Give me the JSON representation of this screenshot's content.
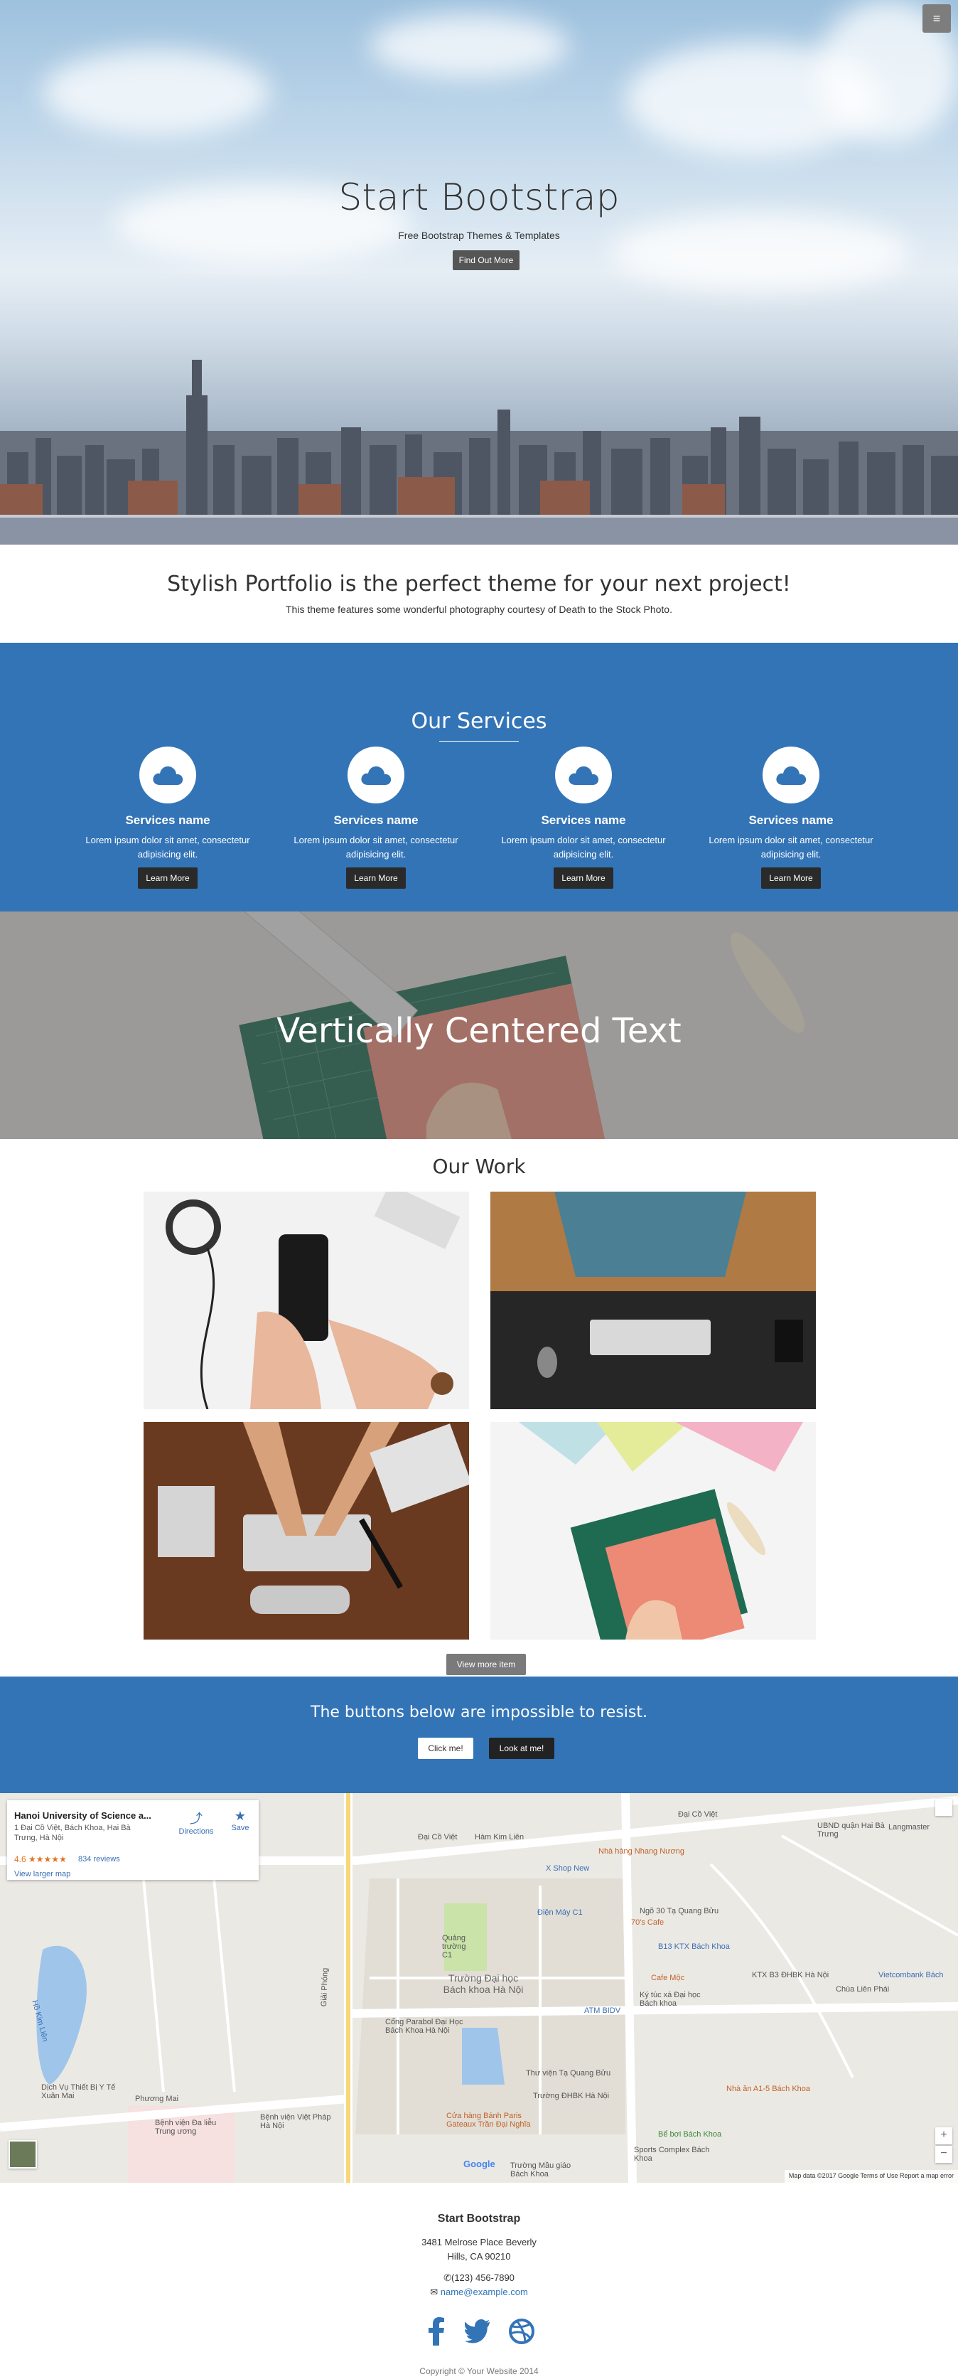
{
  "hero": {
    "title": "Start Bootstrap",
    "subtitle": "Free Bootstrap Themes & Templates",
    "button": "Find Out More",
    "menu_icon": "≡"
  },
  "about": {
    "heading": "Stylish Portfolio is the perfect theme for your next project!",
    "text": "This theme features some wonderful photography courtesy of Death to the Stock Photo."
  },
  "services": {
    "heading": "Our Services",
    "items": [
      {
        "title": "Services name",
        "text": "Lorem ipsum dolor sit amet, consectetur adipisicing elit.",
        "button": "Learn More",
        "icon": "cloud-icon"
      },
      {
        "title": "Services name",
        "text": "Lorem ipsum dolor sit amet, consectetur adipisicing elit.",
        "button": "Learn More",
        "icon": "cloud-icon"
      },
      {
        "title": "Services name",
        "text": "Lorem ipsum dolor sit amet, consectetur adipisicing elit.",
        "button": "Learn More",
        "icon": "cloud-icon"
      },
      {
        "title": "Services name",
        "text": "Lorem ipsum dolor sit amet, consectetur adipisicing elit.",
        "button": "Learn More",
        "icon": "cloud-icon"
      }
    ]
  },
  "callout": {
    "heading": "Vertically Centered Text"
  },
  "portfolio": {
    "heading": "Our Work",
    "button": "View more item"
  },
  "cta": {
    "heading": "The buttons below are impossible to resist.",
    "button1": "Click me!",
    "button2": "Look at me!"
  },
  "map": {
    "place_name": "Hanoi University of Science a...",
    "place_address": "1 Đại Cồ Việt, Bách Khoa, Hai Bà Trưng, Hà Nội",
    "rating": "4.6",
    "stars": "★★★★★",
    "reviews": "834 reviews",
    "larger_map": "View larger map",
    "directions": "Directions",
    "save": "Save",
    "labels": {
      "dai_co_viet": "Đại Cồ Việt",
      "ham_kim_lien": "Hàm Kim Liên",
      "nha_hang": "Nhà hàng Nhang Nương",
      "x_shop": "X Shop New",
      "dien_may": "Điện Máy C1",
      "seventy": "70's Cafe",
      "cafe_moc": "Cafe Mộc",
      "ktx_b3": "B13 KTX Bách Khoa",
      "ktx_b3_2": "KTX B3 ĐHBK Hà Nội",
      "ky_tuc": "Ký túc xá Đại học Bách khoa",
      "atm": "ATM BIDV",
      "truong": "Trường Đại học Bách khoa Hà Nội",
      "cong_parabol": "Cổng Parabol Đại Học Bách Khoa Hà Nội",
      "thu_vien": "Thư viện Tạ Quang Bửu",
      "dhbk": "Trường ĐHBK Hà Nội",
      "quang_truong": "Quảng trường C1",
      "giai_phong": "Giải Phóng",
      "ho_kim_lien": "Hồ Kim Liên",
      "benh_vien": "Bệnh viện Đa liễu Trung ương",
      "benh_vien_phap": "Bệnh viện Việt Pháp Hà Nội",
      "dich_vu": "Dịch Vụ Thiết Bị Y Tế Xuân Mai",
      "phuong_mai": "Phương Mai",
      "cua_hang": "Cửa hàng Bánh Paris Gateaux Trần Đại Nghĩa",
      "be_boi": "Bể bơi Bách Khoa",
      "sports": "Sports Complex Bách Khoa",
      "truong_mau": "Trường Mầu giáo Bách Khoa",
      "nha_an": "Nhà ăn A1-5 Bách Khoa",
      "chua_lien": "Chùa Liên Phái",
      "viettel": "Vietcombank Bách",
      "ubnd": "UBND quận Hai Bà Trưng",
      "langmaster": "Langmaster",
      "ngo_30": "Ngõ 30 Tạ Quang Bửu",
      "google": "Google",
      "footer": "Map data ©2017 Google   Terms of Use   Report a map error"
    }
  },
  "footer": {
    "title": "Start Bootstrap",
    "address1": "3481 Melrose Place Beverly",
    "address2": "Hills, CA 90210",
    "phone": "(123) 456-7890",
    "email": "name@example.com",
    "copyright": "Copyright © Your Website 2014"
  }
}
